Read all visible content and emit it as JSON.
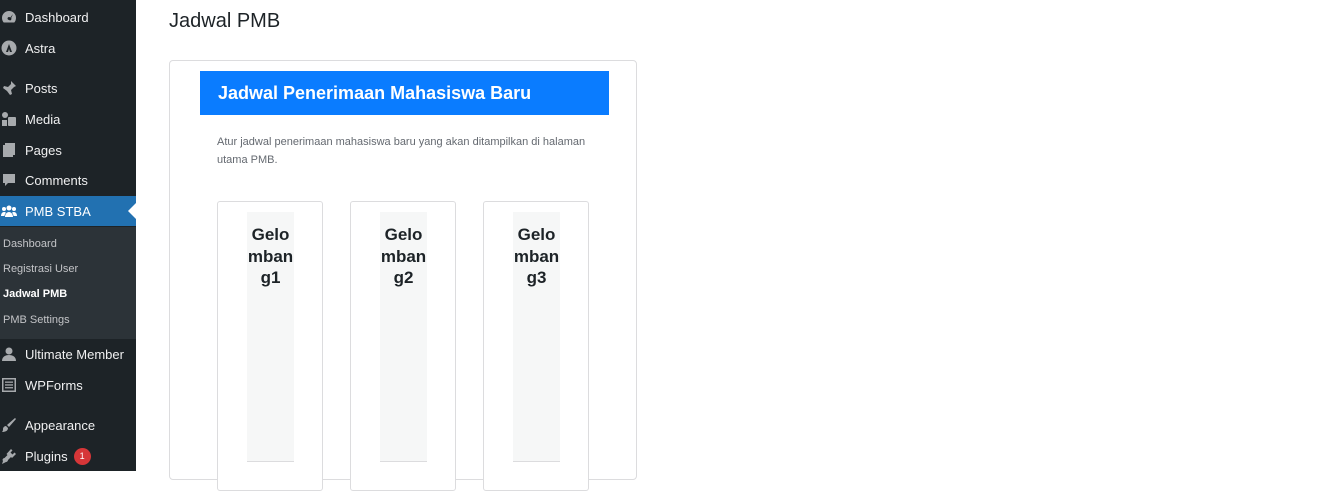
{
  "sidebar": {
    "items": [
      {
        "label": "Dashboard",
        "icon": "dashboard-icon"
      },
      {
        "label": "Astra",
        "icon": "astra-icon"
      },
      {
        "label": "Posts",
        "icon": "pin-icon"
      },
      {
        "label": "Media",
        "icon": "media-icon"
      },
      {
        "label": "Pages",
        "icon": "pages-icon"
      },
      {
        "label": "Comments",
        "icon": "comment-icon"
      },
      {
        "label": "PMB STBA",
        "icon": "groups-icon"
      },
      {
        "label": "Ultimate Member",
        "icon": "user-icon"
      },
      {
        "label": "WPForms",
        "icon": "form-icon"
      },
      {
        "label": "Appearance",
        "icon": "brush-icon"
      },
      {
        "label": "Plugins",
        "icon": "plugin-icon",
        "badge": "1"
      }
    ],
    "submenu": [
      {
        "label": "Dashboard"
      },
      {
        "label": "Registrasi User"
      },
      {
        "label": "Jadwal PMB"
      },
      {
        "label": "PMB Settings"
      }
    ],
    "accent_color": "#2271b1"
  },
  "main": {
    "page_title": "Jadwal PMB",
    "banner_title": "Jadwal Penerimaan Mahasiswa Baru",
    "banner_color": "#0a7cff",
    "description": "Atur jadwal penerimaan mahasiswa baru yang akan ditampilkan di halaman utama PMB.",
    "cards": [
      {
        "title": "Gelombang1"
      },
      {
        "title": "Gelombang2"
      },
      {
        "title": "Gelombang3"
      }
    ]
  }
}
